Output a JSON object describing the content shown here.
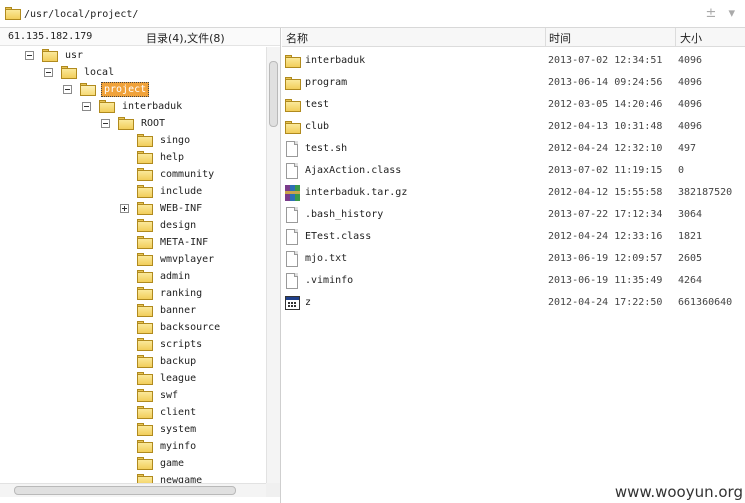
{
  "path_bar": {
    "path": "/usr/local/project/",
    "controls": "± ▾"
  },
  "left_panel": {
    "ip": "61.135.182.179",
    "counts": "目录(4),文件(8)"
  },
  "tree": [
    {
      "label": "usr",
      "depth": 0,
      "expander": "minus",
      "open": false,
      "selected": false
    },
    {
      "label": "local",
      "depth": 1,
      "expander": "minus",
      "open": false,
      "selected": false
    },
    {
      "label": "project",
      "depth": 2,
      "expander": "minus",
      "open": true,
      "selected": true
    },
    {
      "label": "interbaduk",
      "depth": 3,
      "expander": "minus",
      "open": false,
      "selected": false
    },
    {
      "label": "ROOT",
      "depth": 4,
      "expander": "minus",
      "open": false,
      "selected": false
    },
    {
      "label": "singo",
      "depth": 5,
      "expander": "none",
      "open": false,
      "selected": false
    },
    {
      "label": "help",
      "depth": 5,
      "expander": "none",
      "open": false,
      "selected": false
    },
    {
      "label": "community",
      "depth": 5,
      "expander": "none",
      "open": false,
      "selected": false
    },
    {
      "label": "include",
      "depth": 5,
      "expander": "none",
      "open": false,
      "selected": false
    },
    {
      "label": "WEB-INF",
      "depth": 5,
      "expander": "plus",
      "open": false,
      "selected": false
    },
    {
      "label": "design",
      "depth": 5,
      "expander": "none",
      "open": false,
      "selected": false
    },
    {
      "label": "META-INF",
      "depth": 5,
      "expander": "none",
      "open": false,
      "selected": false
    },
    {
      "label": "wmvplayer",
      "depth": 5,
      "expander": "none",
      "open": false,
      "selected": false
    },
    {
      "label": "admin",
      "depth": 5,
      "expander": "none",
      "open": false,
      "selected": false
    },
    {
      "label": "ranking",
      "depth": 5,
      "expander": "none",
      "open": false,
      "selected": false
    },
    {
      "label": "banner",
      "depth": 5,
      "expander": "none",
      "open": false,
      "selected": false
    },
    {
      "label": "backsource",
      "depth": 5,
      "expander": "none",
      "open": false,
      "selected": false
    },
    {
      "label": "scripts",
      "depth": 5,
      "expander": "none",
      "open": false,
      "selected": false
    },
    {
      "label": "backup",
      "depth": 5,
      "expander": "none",
      "open": false,
      "selected": false
    },
    {
      "label": "league",
      "depth": 5,
      "expander": "none",
      "open": false,
      "selected": false
    },
    {
      "label": "swf",
      "depth": 5,
      "expander": "none",
      "open": false,
      "selected": false
    },
    {
      "label": "client",
      "depth": 5,
      "expander": "none",
      "open": false,
      "selected": false
    },
    {
      "label": "system",
      "depth": 5,
      "expander": "none",
      "open": false,
      "selected": false
    },
    {
      "label": "myinfo",
      "depth": 5,
      "expander": "none",
      "open": false,
      "selected": false
    },
    {
      "label": "game",
      "depth": 5,
      "expander": "none",
      "open": false,
      "selected": false
    },
    {
      "label": "newgame",
      "depth": 5,
      "expander": "none",
      "open": false,
      "selected": false
    }
  ],
  "columns": {
    "name": "名称",
    "time": "时间",
    "size": "大小"
  },
  "files": [
    {
      "icon": "folder-icon",
      "name": "interbaduk",
      "time": "2013-07-02 12:34:51",
      "size": "4096"
    },
    {
      "icon": "folder-icon",
      "name": "program",
      "time": "2013-06-14 09:24:56",
      "size": "4096"
    },
    {
      "icon": "folder-icon",
      "name": "test",
      "time": "2012-03-05 14:20:46",
      "size": "4096"
    },
    {
      "icon": "folder-icon",
      "name": "club",
      "time": "2012-04-13 10:31:48",
      "size": "4096"
    },
    {
      "icon": "file-icon",
      "name": "test.sh",
      "time": "2012-04-24 12:32:10",
      "size": "497"
    },
    {
      "icon": "file-icon",
      "name": "AjaxAction.class",
      "time": "2013-07-02 11:19:15",
      "size": "0"
    },
    {
      "icon": "archive-icon",
      "name": "interbaduk.tar.gz",
      "time": "2012-04-12 15:55:58",
      "size": "382187520"
    },
    {
      "icon": "file-icon",
      "name": ".bash_history",
      "time": "2013-07-22 17:12:34",
      "size": "3064"
    },
    {
      "icon": "file-icon",
      "name": "ETest.class",
      "time": "2012-04-24 12:33:16",
      "size": "1821"
    },
    {
      "icon": "file-icon",
      "name": "mjo.txt",
      "time": "2013-06-19 12:09:57",
      "size": "2605"
    },
    {
      "icon": "file-icon",
      "name": ".viminfo",
      "time": "2013-06-19 11:35:49",
      "size": "4264"
    },
    {
      "icon": "executable-icon",
      "name": "z",
      "time": "2012-04-24 17:22:50",
      "size": "661360640"
    }
  ],
  "watermark": "www.wooyun.org"
}
